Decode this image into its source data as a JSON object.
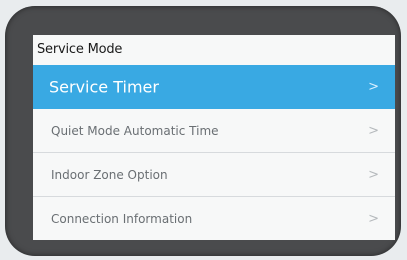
{
  "header": {
    "title": "Service Mode"
  },
  "menu": {
    "items": [
      {
        "label": "Service Timer",
        "chevron": ">"
      },
      {
        "label": "Quiet Mode Automatic Time",
        "chevron": ">"
      },
      {
        "label": "Indoor Zone Option",
        "chevron": ">"
      },
      {
        "label": "Connection Information",
        "chevron": ">"
      }
    ],
    "selected_index": 0
  },
  "colors": {
    "bezel": "#4a4b4d",
    "screen_background": "#f7f8f8",
    "selected_highlight": "#39a9e3",
    "item_text": "#6a6f73"
  }
}
